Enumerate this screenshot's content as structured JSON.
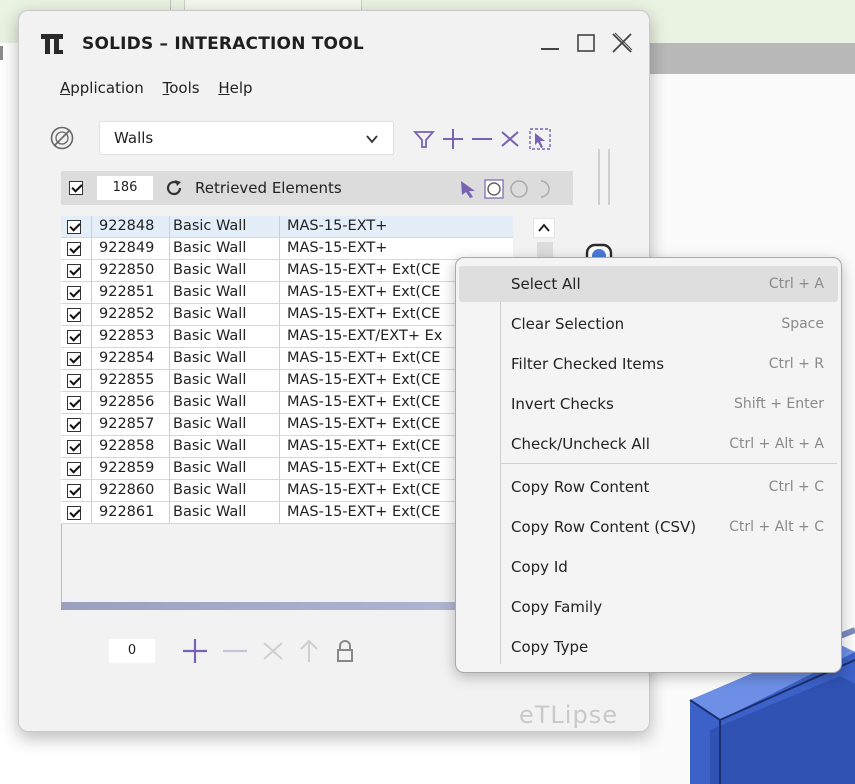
{
  "window": {
    "title": "SOLIDS – INTERACTION TOOL",
    "logo_text": "TL"
  },
  "menu": [
    "Application",
    "Tools",
    "Help"
  ],
  "selector": {
    "value": "Walls"
  },
  "list": {
    "count": "186",
    "header_label": "Retrieved Elements",
    "rows": [
      {
        "id": "922848",
        "family": "Basic Wall",
        "type": "MAS-15-EXT+",
        "checked": true
      },
      {
        "id": "922849",
        "family": "Basic Wall",
        "type": "MAS-15-EXT+",
        "checked": true
      },
      {
        "id": "922850",
        "family": "Basic Wall",
        "type": "MAS-15-EXT+ Ext(CE",
        "checked": true
      },
      {
        "id": "922851",
        "family": "Basic Wall",
        "type": "MAS-15-EXT+ Ext(CE",
        "checked": true
      },
      {
        "id": "922852",
        "family": "Basic Wall",
        "type": "MAS-15-EXT+ Ext(CE",
        "checked": true
      },
      {
        "id": "922853",
        "family": "Basic Wall",
        "type": "MAS-15-EXT/EXT+ Ex",
        "checked": true
      },
      {
        "id": "922854",
        "family": "Basic Wall",
        "type": "MAS-15-EXT+ Ext(CE",
        "checked": true
      },
      {
        "id": "922855",
        "family": "Basic Wall",
        "type": "MAS-15-EXT+ Ext(CE",
        "checked": true
      },
      {
        "id": "922856",
        "family": "Basic Wall",
        "type": "MAS-15-EXT+ Ext(CE",
        "checked": true
      },
      {
        "id": "922857",
        "family": "Basic Wall",
        "type": "MAS-15-EXT+ Ext(CE",
        "checked": true
      },
      {
        "id": "922858",
        "family": "Basic Wall",
        "type": "MAS-15-EXT+ Ext(CE",
        "checked": true
      },
      {
        "id": "922859",
        "family": "Basic Wall",
        "type": "MAS-15-EXT+ Ext(CE",
        "checked": true
      },
      {
        "id": "922860",
        "family": "Basic Wall",
        "type": "MAS-15-EXT+ Ext(CE",
        "checked": true
      },
      {
        "id": "922861",
        "family": "Basic Wall",
        "type": "MAS-15-EXT+ Ext(CE",
        "checked": true
      }
    ]
  },
  "footer": {
    "count": "0"
  },
  "watermark": "eTLipse",
  "context_menu": {
    "items": [
      {
        "label": "Select All",
        "shortcut": "Ctrl + A"
      },
      {
        "label": "Clear Selection",
        "shortcut": "Space"
      },
      {
        "label": "Filter Checked Items",
        "shortcut": "Ctrl + R"
      },
      {
        "label": "Invert Checks",
        "shortcut": "Shift + Enter"
      },
      {
        "label": "Check/Uncheck All",
        "shortcut": "Ctrl + Alt + A"
      },
      {
        "label": "Copy Row Content",
        "shortcut": "Ctrl + C"
      },
      {
        "label": "Copy Row Content (CSV)",
        "shortcut": "Ctrl + Alt + C"
      },
      {
        "label": "Copy Id",
        "shortcut": ""
      },
      {
        "label": "Copy Family",
        "shortcut": ""
      },
      {
        "label": "Copy Type",
        "shortcut": ""
      }
    ]
  },
  "colors": {
    "accent_purple": "#9aa0bf",
    "window_bg": "#f2f2f2",
    "bg_blue_model": "#3f6fd8"
  }
}
